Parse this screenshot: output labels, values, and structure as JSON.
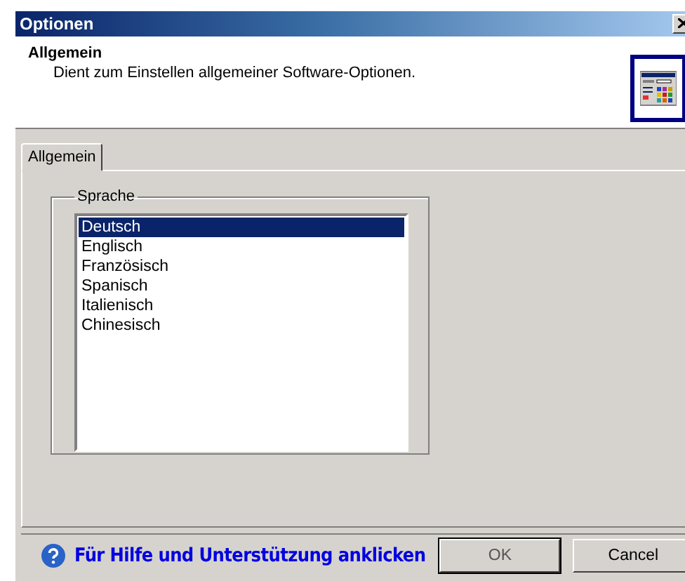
{
  "window": {
    "title": "Optionen"
  },
  "header": {
    "title": "Allgemein",
    "description": "Dient zum Einstellen allgemeiner Software-Optionen."
  },
  "tabs": [
    {
      "label": "Allgemein",
      "selected": true
    }
  ],
  "group": {
    "title": "Sprache"
  },
  "languages": [
    {
      "label": "Deutsch",
      "selected": true
    },
    {
      "label": "Englisch",
      "selected": false
    },
    {
      "label": "Französisch",
      "selected": false
    },
    {
      "label": "Spanisch",
      "selected": false
    },
    {
      "label": "Italienisch",
      "selected": false
    },
    {
      "label": "Chinesisch",
      "selected": false
    }
  ],
  "help_link": "Für Hilfe und Unterstützung anklicken",
  "buttons": [
    {
      "label": "OK",
      "default": true
    },
    {
      "label": "Cancel",
      "default": false
    }
  ]
}
